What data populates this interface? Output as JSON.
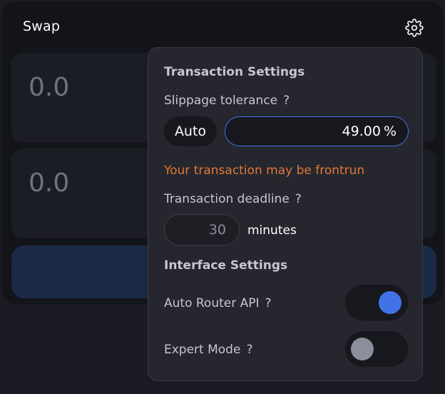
{
  "swap": {
    "title": "Swap",
    "input_amount": "0.0",
    "output_amount": "0.0"
  },
  "settings": {
    "transaction_heading": "Transaction Settings",
    "slippage_label": "Slippage tolerance",
    "help_mark": "?",
    "auto_label": "Auto",
    "slippage_value": "49.00",
    "percent_sign": "%",
    "warning": "Your transaction may be frontrun",
    "deadline_label": "Transaction deadline",
    "deadline_value": "30",
    "deadline_unit": "minutes",
    "interface_heading": "Interface Settings",
    "auto_router_label": "Auto Router API",
    "auto_router_enabled": true,
    "expert_mode_label": "Expert Mode",
    "expert_mode_enabled": false
  },
  "icons": {
    "settings": "gear-icon"
  },
  "colors": {
    "accent_blue": "#4173e6",
    "warning_orange": "#e0783a",
    "toggle_off": "#8b8f9c"
  }
}
